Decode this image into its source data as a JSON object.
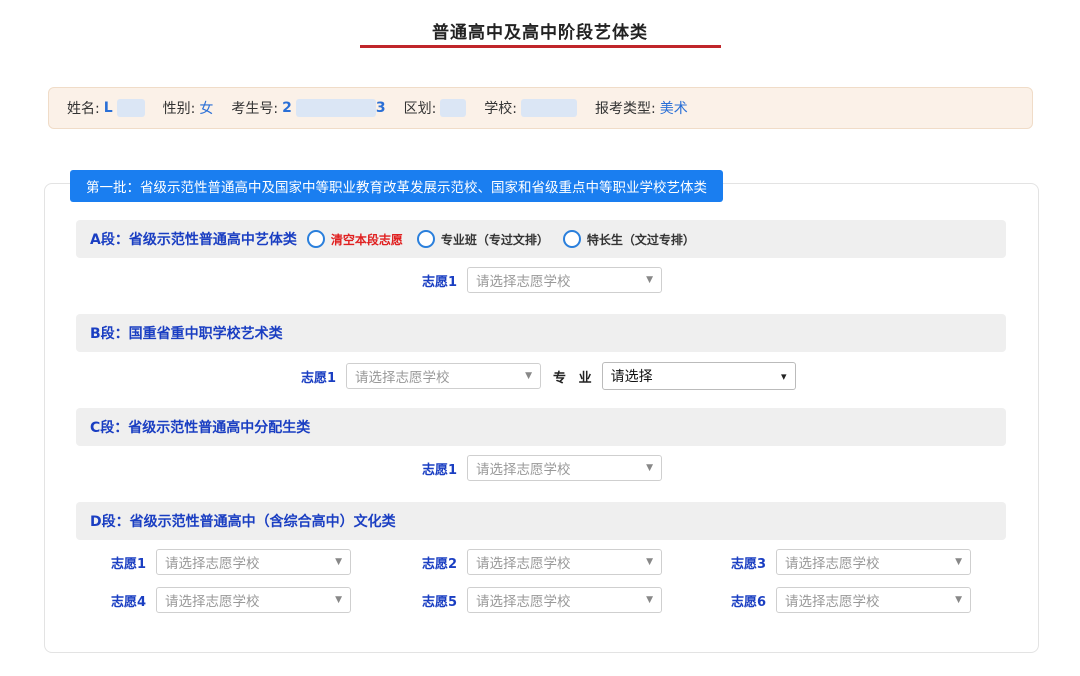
{
  "title": "普通高中及高中阶段艺体类",
  "info": {
    "name_label": "姓名:",
    "name_value": "L",
    "gender_label": "性别:",
    "gender_value": "女",
    "exam_no_label": "考生号:",
    "exam_no_prefix": "2",
    "exam_no_suffix": "3",
    "district_label": "区划:",
    "school_label": "学校:",
    "type_label": "报考类型:",
    "type_value": "美术"
  },
  "batch": {
    "label": "第一批：省级示范性普通高中及国家中等职业教育改革发展示范校、国家和省级重点中等职业学校艺体类"
  },
  "segments": {
    "a": {
      "title": "A段：省级示范性普通高中艺体类",
      "radios": [
        "清空本段志愿",
        "专业班（专过文排）",
        "特长生（文过专排）"
      ],
      "wish_label": "志愿1",
      "placeholder": "请选择志愿学校"
    },
    "b": {
      "title": "B段：国重省重中职学校艺术类",
      "wish_label": "志愿1",
      "placeholder": "请选择志愿学校",
      "major_label": "专 业",
      "major_value": "请选择"
    },
    "c": {
      "title": "C段：省级示范性普通高中分配生类",
      "wish_label": "志愿1",
      "placeholder": "请选择志愿学校"
    },
    "d": {
      "title": "D段：省级示范性普通高中（含综合高中）文化类",
      "wishes": [
        {
          "label": "志愿1",
          "placeholder": "请选择志愿学校"
        },
        {
          "label": "志愿2",
          "placeholder": "请选择志愿学校"
        },
        {
          "label": "志愿3",
          "placeholder": "请选择志愿学校"
        },
        {
          "label": "志愿4",
          "placeholder": "请选择志愿学校"
        },
        {
          "label": "志愿5",
          "placeholder": "请选择志愿学校"
        },
        {
          "label": "志愿6",
          "placeholder": "请选择志愿学校"
        }
      ]
    }
  },
  "colors": {
    "accent_blue": "#1a7ef0",
    "title_underline": "#c0262a",
    "segment_title": "#1a3ec2",
    "clear_option": "#e02020"
  },
  "icons": {
    "caret": "▼",
    "chevron": "⌄"
  }
}
